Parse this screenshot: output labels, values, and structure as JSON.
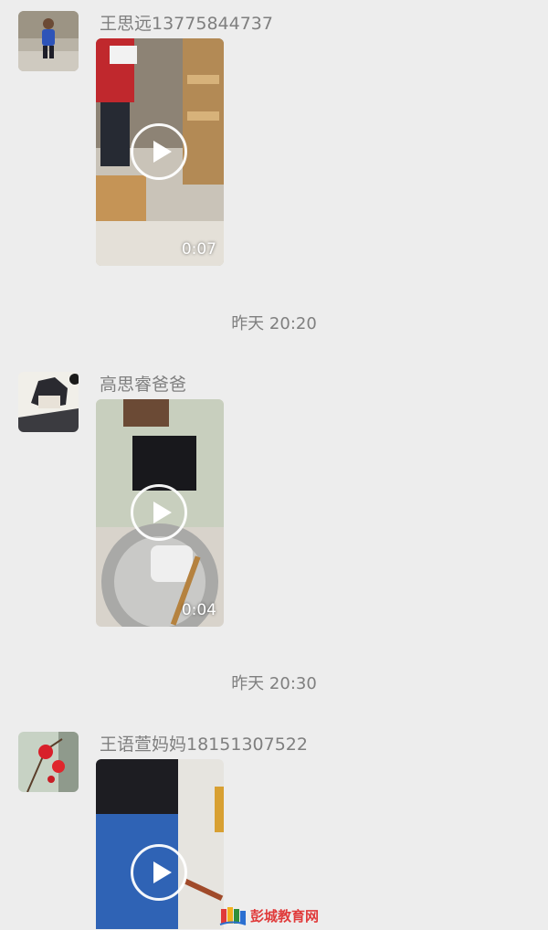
{
  "messages": [
    {
      "sender": "王思远13775844737",
      "duration": "0:07",
      "avatar": "child-photo-avatar"
    },
    {
      "sender": "高思睿爸爸",
      "duration": "0:04",
      "avatar": "anime-boy-avatar"
    },
    {
      "sender": "王语萱妈妈18151307522",
      "duration": "",
      "avatar": "red-flower-avatar"
    }
  ],
  "timestamps": [
    "昨天 20:20",
    "昨天 20:30"
  ],
  "watermark": {
    "text": "彭城教育网",
    "icon": "books-logo-icon"
  },
  "colors": {
    "background": "#ededed",
    "sender_text": "#7f7f7f",
    "watermark": "#e03a3a"
  }
}
